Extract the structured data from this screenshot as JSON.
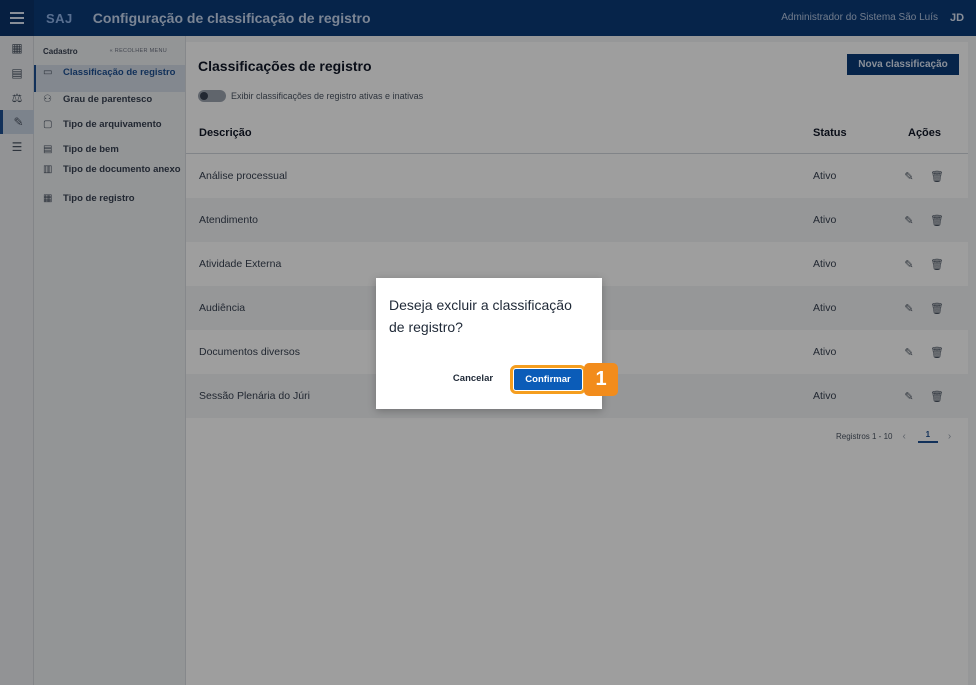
{
  "topbar": {
    "brand": "SAJ",
    "title": "Configuração de classificação de registro",
    "user": "Administrador do Sistema São Luís",
    "avatar": "JD"
  },
  "rail": {
    "items": [
      {
        "icon": "calendar-icon",
        "glyph": "▦",
        "active": false
      },
      {
        "icon": "document-icon",
        "glyph": "▤",
        "active": false
      },
      {
        "icon": "scale-icon",
        "glyph": "⚖",
        "active": false
      },
      {
        "icon": "edit-document-icon",
        "glyph": "✎",
        "active": true
      },
      {
        "icon": "sliders-icon",
        "glyph": "☰",
        "active": false
      }
    ]
  },
  "submenu": {
    "title": "Cadastro",
    "collapse": "« RECOLHER MENU",
    "items": [
      {
        "label": "Classificação de registro",
        "icon": "▭",
        "active": true
      },
      {
        "label": "Grau de parentesco",
        "icon": "⚇",
        "active": false
      },
      {
        "label": "Tipo de arquivamento",
        "icon": "▢",
        "active": false
      },
      {
        "label": "Tipo de bem",
        "icon": "▤",
        "active": false
      },
      {
        "label": "Tipo de documento anexo",
        "icon": "▥",
        "active": false
      },
      {
        "label": "Tipo de registro",
        "icon": "▦",
        "active": false
      }
    ]
  },
  "main": {
    "title": "Classificações de registro",
    "new_button": "Nova classificação",
    "toggle_label": "Exibir classificações de registro ativas e inativas",
    "columns": {
      "description": "Descrição",
      "status": "Status",
      "actions": "Ações"
    },
    "rows": [
      {
        "description": "Análise processual",
        "status": "Ativo"
      },
      {
        "description": "Atendimento",
        "status": "Ativo"
      },
      {
        "description": "Atividade Externa",
        "status": "Ativo"
      },
      {
        "description": "Audiência",
        "status": "Ativo"
      },
      {
        "description": "Documentos diversos",
        "status": "Ativo"
      },
      {
        "description": "Sessão Plenária do Júri",
        "status": "Ativo"
      }
    ],
    "pager": {
      "range": "Registros 1 - 10",
      "prev": "‹",
      "page": "1",
      "next": "›"
    }
  },
  "dialog": {
    "message": "Deseja excluir a classificação de registro?",
    "cancel": "Cancelar",
    "confirm": "Confirmar"
  },
  "annotation": {
    "step": "1",
    "color": "#f28c1c"
  },
  "colors": {
    "primary": "#0b3a78",
    "confirm": "#0b5cb8",
    "highlight": "#f59e1f"
  }
}
